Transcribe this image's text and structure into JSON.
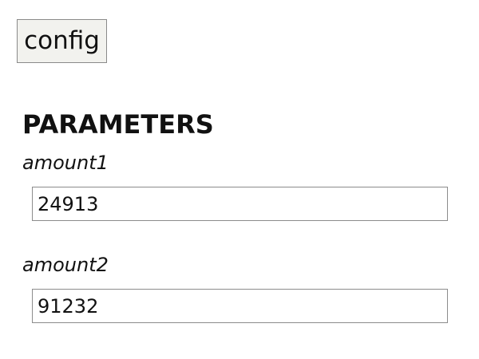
{
  "toolbar": {
    "config_label": "config"
  },
  "parameters": {
    "heading": "PARAMETERS",
    "fields": [
      {
        "label": "amount1",
        "value": "24913"
      },
      {
        "label": "amount2",
        "value": "91232"
      }
    ]
  },
  "colors": {
    "button_background": "#f2f2ee",
    "border": "#8c8c8c",
    "text": "#111111"
  }
}
